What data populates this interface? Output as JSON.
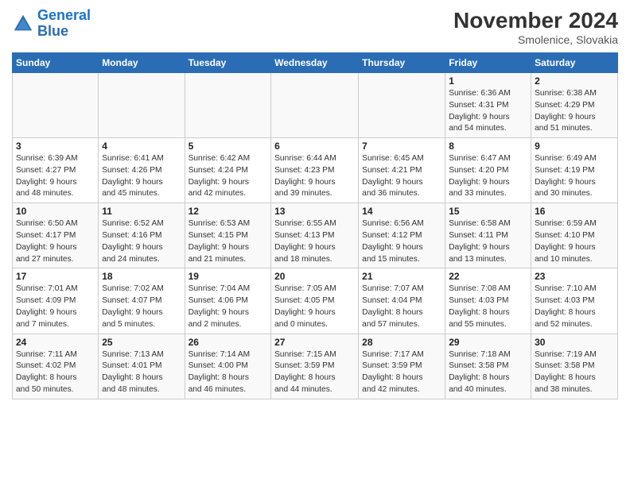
{
  "logo": {
    "line1": "General",
    "line2": "Blue"
  },
  "title": "November 2024",
  "subtitle": "Smolenice, Slovakia",
  "days_header": [
    "Sunday",
    "Monday",
    "Tuesday",
    "Wednesday",
    "Thursday",
    "Friday",
    "Saturday"
  ],
  "weeks": [
    [
      {
        "day": "",
        "info": ""
      },
      {
        "day": "",
        "info": ""
      },
      {
        "day": "",
        "info": ""
      },
      {
        "day": "",
        "info": ""
      },
      {
        "day": "",
        "info": ""
      },
      {
        "day": "1",
        "info": "Sunrise: 6:36 AM\nSunset: 4:31 PM\nDaylight: 9 hours\nand 54 minutes."
      },
      {
        "day": "2",
        "info": "Sunrise: 6:38 AM\nSunset: 4:29 PM\nDaylight: 9 hours\nand 51 minutes."
      }
    ],
    [
      {
        "day": "3",
        "info": "Sunrise: 6:39 AM\nSunset: 4:27 PM\nDaylight: 9 hours\nand 48 minutes."
      },
      {
        "day": "4",
        "info": "Sunrise: 6:41 AM\nSunset: 4:26 PM\nDaylight: 9 hours\nand 45 minutes."
      },
      {
        "day": "5",
        "info": "Sunrise: 6:42 AM\nSunset: 4:24 PM\nDaylight: 9 hours\nand 42 minutes."
      },
      {
        "day": "6",
        "info": "Sunrise: 6:44 AM\nSunset: 4:23 PM\nDaylight: 9 hours\nand 39 minutes."
      },
      {
        "day": "7",
        "info": "Sunrise: 6:45 AM\nSunset: 4:21 PM\nDaylight: 9 hours\nand 36 minutes."
      },
      {
        "day": "8",
        "info": "Sunrise: 6:47 AM\nSunset: 4:20 PM\nDaylight: 9 hours\nand 33 minutes."
      },
      {
        "day": "9",
        "info": "Sunrise: 6:49 AM\nSunset: 4:19 PM\nDaylight: 9 hours\nand 30 minutes."
      }
    ],
    [
      {
        "day": "10",
        "info": "Sunrise: 6:50 AM\nSunset: 4:17 PM\nDaylight: 9 hours\nand 27 minutes."
      },
      {
        "day": "11",
        "info": "Sunrise: 6:52 AM\nSunset: 4:16 PM\nDaylight: 9 hours\nand 24 minutes."
      },
      {
        "day": "12",
        "info": "Sunrise: 6:53 AM\nSunset: 4:15 PM\nDaylight: 9 hours\nand 21 minutes."
      },
      {
        "day": "13",
        "info": "Sunrise: 6:55 AM\nSunset: 4:13 PM\nDaylight: 9 hours\nand 18 minutes."
      },
      {
        "day": "14",
        "info": "Sunrise: 6:56 AM\nSunset: 4:12 PM\nDaylight: 9 hours\nand 15 minutes."
      },
      {
        "day": "15",
        "info": "Sunrise: 6:58 AM\nSunset: 4:11 PM\nDaylight: 9 hours\nand 13 minutes."
      },
      {
        "day": "16",
        "info": "Sunrise: 6:59 AM\nSunset: 4:10 PM\nDaylight: 9 hours\nand 10 minutes."
      }
    ],
    [
      {
        "day": "17",
        "info": "Sunrise: 7:01 AM\nSunset: 4:09 PM\nDaylight: 9 hours\nand 7 minutes."
      },
      {
        "day": "18",
        "info": "Sunrise: 7:02 AM\nSunset: 4:07 PM\nDaylight: 9 hours\nand 5 minutes."
      },
      {
        "day": "19",
        "info": "Sunrise: 7:04 AM\nSunset: 4:06 PM\nDaylight: 9 hours\nand 2 minutes."
      },
      {
        "day": "20",
        "info": "Sunrise: 7:05 AM\nSunset: 4:05 PM\nDaylight: 9 hours\nand 0 minutes."
      },
      {
        "day": "21",
        "info": "Sunrise: 7:07 AM\nSunset: 4:04 PM\nDaylight: 8 hours\nand 57 minutes."
      },
      {
        "day": "22",
        "info": "Sunrise: 7:08 AM\nSunset: 4:03 PM\nDaylight: 8 hours\nand 55 minutes."
      },
      {
        "day": "23",
        "info": "Sunrise: 7:10 AM\nSunset: 4:03 PM\nDaylight: 8 hours\nand 52 minutes."
      }
    ],
    [
      {
        "day": "24",
        "info": "Sunrise: 7:11 AM\nSunset: 4:02 PM\nDaylight: 8 hours\nand 50 minutes."
      },
      {
        "day": "25",
        "info": "Sunrise: 7:13 AM\nSunset: 4:01 PM\nDaylight: 8 hours\nand 48 minutes."
      },
      {
        "day": "26",
        "info": "Sunrise: 7:14 AM\nSunset: 4:00 PM\nDaylight: 8 hours\nand 46 minutes."
      },
      {
        "day": "27",
        "info": "Sunrise: 7:15 AM\nSunset: 3:59 PM\nDaylight: 8 hours\nand 44 minutes."
      },
      {
        "day": "28",
        "info": "Sunrise: 7:17 AM\nSunset: 3:59 PM\nDaylight: 8 hours\nand 42 minutes."
      },
      {
        "day": "29",
        "info": "Sunrise: 7:18 AM\nSunset: 3:58 PM\nDaylight: 8 hours\nand 40 minutes."
      },
      {
        "day": "30",
        "info": "Sunrise: 7:19 AM\nSunset: 3:58 PM\nDaylight: 8 hours\nand 38 minutes."
      }
    ]
  ]
}
